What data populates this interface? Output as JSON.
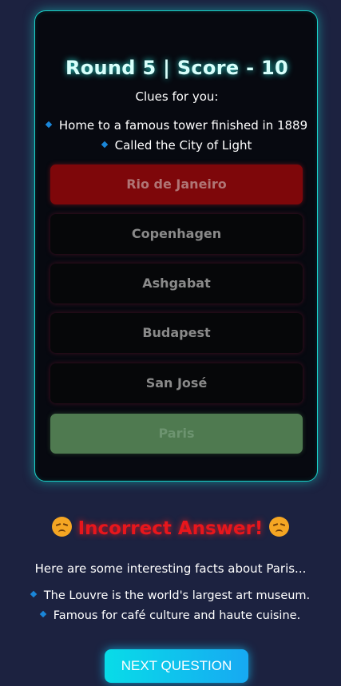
{
  "header": {
    "title": "Round 5 | Score - 10"
  },
  "clues": {
    "heading": "Clues for you:",
    "items": [
      "Home to a famous tower finished in 1889",
      "Called the City of Light"
    ]
  },
  "options": [
    {
      "label": "Rio de Janeiro",
      "state": "incorrect-selected"
    },
    {
      "label": "Copenhagen",
      "state": "default"
    },
    {
      "label": "Ashgabat",
      "state": "default"
    },
    {
      "label": "Budapest",
      "state": "default"
    },
    {
      "label": "San José",
      "state": "default"
    },
    {
      "label": "Paris",
      "state": "correct"
    }
  ],
  "result": {
    "message": "Incorrect Answer!",
    "icon": "disappointed-face-icon"
  },
  "facts": {
    "heading": "Here are some interesting facts about Paris...",
    "items": [
      "The Louvre is the world's largest art museum.",
      "Famous for café culture and haute cuisine."
    ]
  },
  "actions": {
    "next_label": "NEXT QUESTION"
  },
  "colors": {
    "background": "#1c2240",
    "card_border": "#19d2c8",
    "incorrect": "#7e070a",
    "correct": "#4f7a50",
    "result_text": "#e8161c",
    "bullet": "#1a86d8"
  }
}
